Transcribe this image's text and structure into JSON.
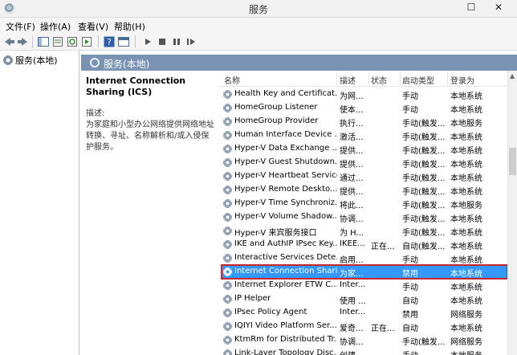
{
  "window": {
    "title": "服务",
    "minimize": "–",
    "maximize": "☐",
    "close": "✕"
  },
  "menu": [
    "文件(F)",
    "操作(A)",
    "查看(V)",
    "帮助(H)"
  ],
  "toolbar": {
    "icons": [
      "back-icon",
      "forward-icon",
      "show-tree-icon",
      "properties-icon",
      "refresh-icon",
      "export-icon",
      "help-icon",
      "console-icon",
      "play-icon",
      "stop-icon",
      "pause-icon",
      "restart-icon"
    ]
  },
  "tree": {
    "root": "服务(本地)"
  },
  "main": {
    "header": "服务(本地)",
    "selected_title": "Internet Connection Sharing (ICS)",
    "desc_label": "描述:",
    "desc_body": "为家庭和小型办公网络提供网络地址转换、寻址、名称解析和/或入侵保护服务。"
  },
  "columns": [
    "名称",
    "描述",
    "状态",
    "启动类型",
    "登录为"
  ],
  "services": [
    {
      "name": "Health Key and Certificat...",
      "desc": "为网...",
      "status": "",
      "type": "手动",
      "logon": "本地系统"
    },
    {
      "name": "HomeGroup Listener",
      "desc": "使本...",
      "status": "",
      "type": "手动",
      "logon": "本地系统"
    },
    {
      "name": "HomeGroup Provider",
      "desc": "执行...",
      "status": "",
      "type": "手动(触发...",
      "logon": "本地服务"
    },
    {
      "name": "Human Interface Device ...",
      "desc": "激活...",
      "status": "",
      "type": "手动(触发...",
      "logon": "本地系统"
    },
    {
      "name": "Hyper-V Data Exchange ...",
      "desc": "提供...",
      "status": "",
      "type": "手动(触发...",
      "logon": "本地系统"
    },
    {
      "name": "Hyper-V Guest Shutdown...",
      "desc": "提供...",
      "status": "",
      "type": "手动(触发...",
      "logon": "本地系统"
    },
    {
      "name": "Hyper-V Heartbeat Service",
      "desc": "通过...",
      "status": "",
      "type": "手动(触发...",
      "logon": "本地系统"
    },
    {
      "name": "Hyper-V Remote Deskto...",
      "desc": "提供...",
      "status": "",
      "type": "手动(触发...",
      "logon": "本地系统"
    },
    {
      "name": "Hyper-V Time Synchroniz...",
      "desc": "将此...",
      "status": "",
      "type": "手动(触发...",
      "logon": "本地服务"
    },
    {
      "name": "Hyper-V Volume Shadow...",
      "desc": "协调...",
      "status": "",
      "type": "手动(触发...",
      "logon": "本地系统"
    },
    {
      "name": "Hyper-V 来宾服务接口",
      "desc": "为 H...",
      "status": "",
      "type": "手动(触发...",
      "logon": "本地系统"
    },
    {
      "name": "IKE and AuthIP IPsec Key...",
      "desc": "IKEE...",
      "status": "正在...",
      "type": "自动(触发...",
      "logon": "本地系统"
    },
    {
      "name": "Interactive Services Dete...",
      "desc": "启用...",
      "status": "",
      "type": "手动",
      "logon": "本地系统"
    },
    {
      "name": "Internet Connection Shari...",
      "desc": "为家...",
      "status": "",
      "type": "禁用",
      "logon": "本地系统",
      "selected": true
    },
    {
      "name": "Internet Explorer ETW C...",
      "desc": "Inter...",
      "status": "",
      "type": "手动",
      "logon": "本地系统"
    },
    {
      "name": "IP Helper",
      "desc": "使用 ...",
      "status": "",
      "type": "自动",
      "logon": "本地系统"
    },
    {
      "name": "IPsec Policy Agent",
      "desc": "Inter...",
      "status": "",
      "type": "禁用",
      "logon": "网络服务"
    },
    {
      "name": "IQIYI Video Platform Ser...",
      "desc": "爱奇...",
      "status": "正在...",
      "type": "自动",
      "logon": "本地系统"
    },
    {
      "name": "KtmRm for Distributed Tr...",
      "desc": "协调...",
      "status": "",
      "type": "手动(触发...",
      "logon": "网络服务"
    },
    {
      "name": "Link-Layer Topology Disc...",
      "desc": "创建...",
      "status": "",
      "type": "手动",
      "logon": "本地服务"
    }
  ],
  "colors": {
    "header_bg": "#7a93b3",
    "selection": "#3399ff",
    "highlight_border": "#c8282d"
  }
}
